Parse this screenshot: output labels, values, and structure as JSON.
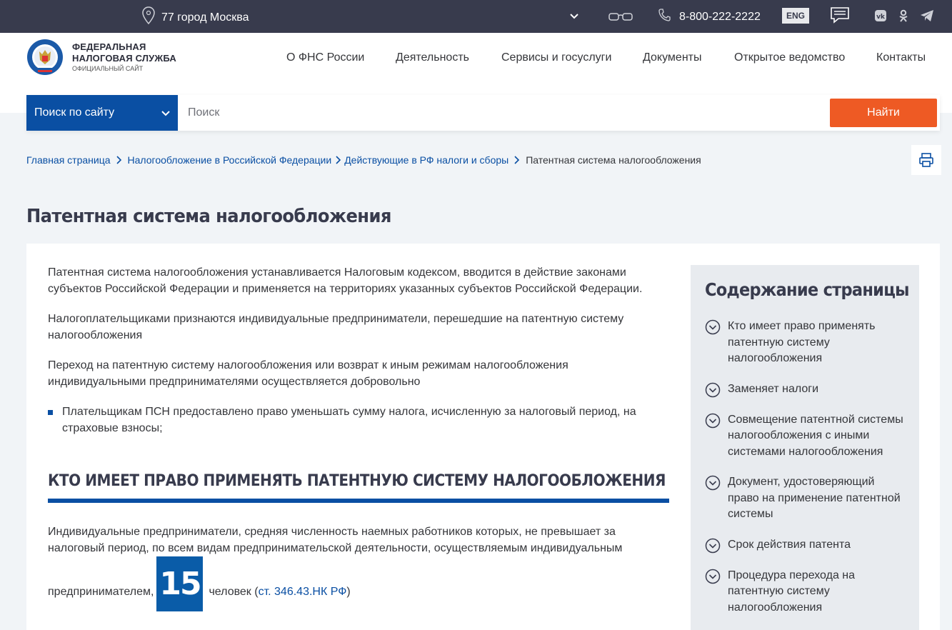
{
  "topbar": {
    "location": "77 город Москва",
    "phone": "8-800-222-2222",
    "lang": "ENG"
  },
  "logo": {
    "line1": "ФЕДЕРАЛЬНАЯ",
    "line2": "НАЛОГОВАЯ СЛУЖБА",
    "line3": "ОФИЦИАЛЬНЫЙ САЙТ"
  },
  "nav": {
    "items": [
      "О ФНС России",
      "Деятельность",
      "Сервисы и госуслуги",
      "Документы",
      "Открытое ведомство",
      "Контакты"
    ]
  },
  "search": {
    "scope": "Поиск по сайту",
    "placeholder": "Поиск",
    "button": "Найти"
  },
  "breadcrumb": {
    "items": [
      "Главная страница",
      "Налогообложение в Российской Федерации",
      "Действующие в РФ налоги и сборы"
    ],
    "current": "Патентная система налогообложения"
  },
  "page": {
    "title": "Патентная система налогообложения",
    "paragraphs": [
      "Патентная система налогообложения устанавливается Налоговым кодексом, вводится в действие законами субъектов Российской Федерации и применяется на территориях указанных субъектов Российской Федерации.",
      "Налогоплательщиками признаются индивидуальные предприниматели, перешедшие на патентную систему налогообложения",
      "Переход на патентную систему налогообложения или возврат к иным режимам налогообложения индивидуальными предпринимателями осуществляется добровольно"
    ],
    "bullet": "Плательщикам ПСН предоставлено право уменьшать сумму налога, исчисленную за налоговый период, на страховые взносы;",
    "section_title": "КТО ИМЕЕТ ПРАВО ПРИМЕНЯТЬ ПАТЕНТНУЮ СИСТЕМУ НАЛОГООБЛОЖЕНИЯ",
    "section_text": "Индивидуальные предприниматели, средняя численность наемных работников которых, не превышает за налоговый период,  по всем видам предпринимательской деятельности, осуществляемым индивидуальным",
    "section_text_2": "предпринимателем,",
    "highlight_number": "15",
    "section_text_3": "человек (",
    "section_link": "ст. 346.43.НК РФ",
    "section_text_4": ")"
  },
  "toc": {
    "title": "Содержание страницы",
    "items": [
      "Кто имеет право применять патентную систему налогообложения",
      "Заменяет налоги",
      "Совмещение патентной системы налогообложения с иными системами налогообложения",
      "Документ, удостоверяющий право на применение патентной системы",
      "Срок действия патента",
      "Процедура перехода на патентную систему налогообложения"
    ]
  }
}
